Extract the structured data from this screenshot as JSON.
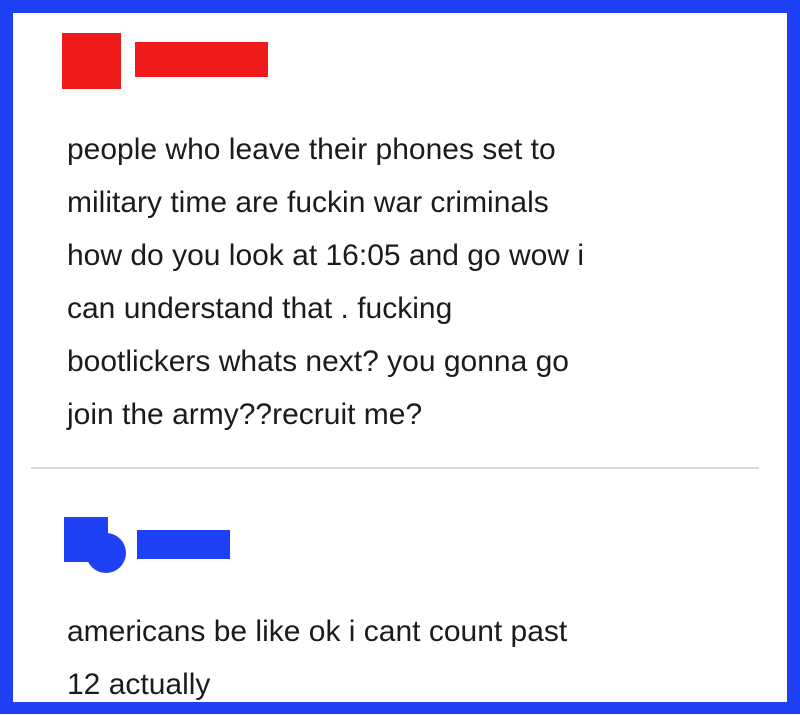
{
  "posts": [
    {
      "avatar_color": "#ef1a1a",
      "username_redacted": true,
      "lines": [
        "people who leave their phones set to",
        "military time are fuckin war criminals",
        "how do you look at 16:05 and go wow i",
        "can understand that . fucking",
        "bootlickers whats next? you gonna go",
        "join the army??recruit me?"
      ]
    },
    {
      "avatar_color": "#1f41f5",
      "username_redacted": true,
      "lines": [
        "americans be like ok i cant count past",
        "12 actually"
      ]
    }
  ],
  "frame_color": "#1f41f5"
}
